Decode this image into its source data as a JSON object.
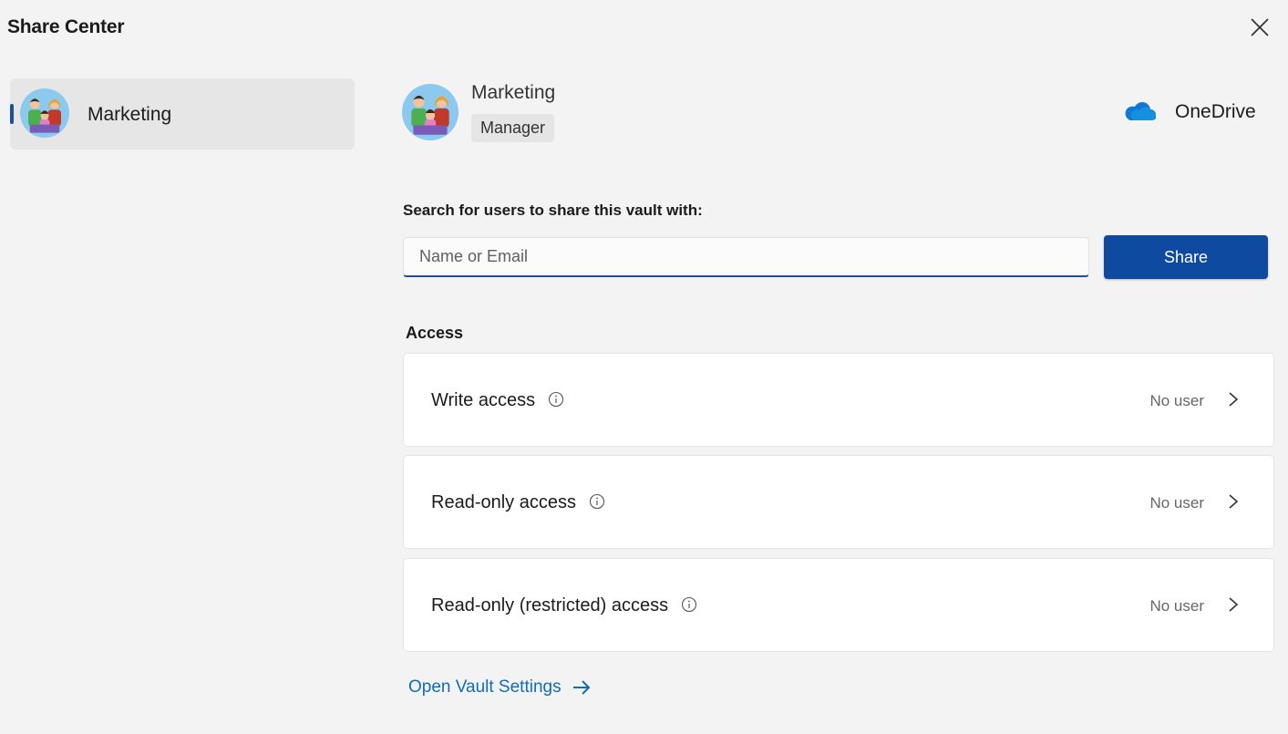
{
  "app": {
    "title": "Share Center",
    "close_icon": "close-icon"
  },
  "sidebar": {
    "items": [
      {
        "label": "Marketing",
        "avatar_icon": "group-avatar-icon",
        "selected": true
      }
    ]
  },
  "header": {
    "vault_name": "Marketing",
    "role": "Manager",
    "cloud_provider": "OneDrive",
    "cloud_icon": "onedrive-cloud-icon"
  },
  "search": {
    "label": "Search for users to share this vault with:",
    "placeholder": "Name or Email",
    "value": "",
    "share_button": "Share"
  },
  "access": {
    "heading": "Access",
    "items": [
      {
        "label": "Write access",
        "status": "No user"
      },
      {
        "label": "Read-only access",
        "status": "No user"
      },
      {
        "label": "Read-only (restricted) access",
        "status": "No user"
      }
    ]
  },
  "footer": {
    "settings_link": "Open Vault Settings"
  },
  "colors": {
    "background": "#f3f3f3",
    "accent": "#0f4aa1",
    "link": "#0f6cbd",
    "card": "#ffffff"
  }
}
